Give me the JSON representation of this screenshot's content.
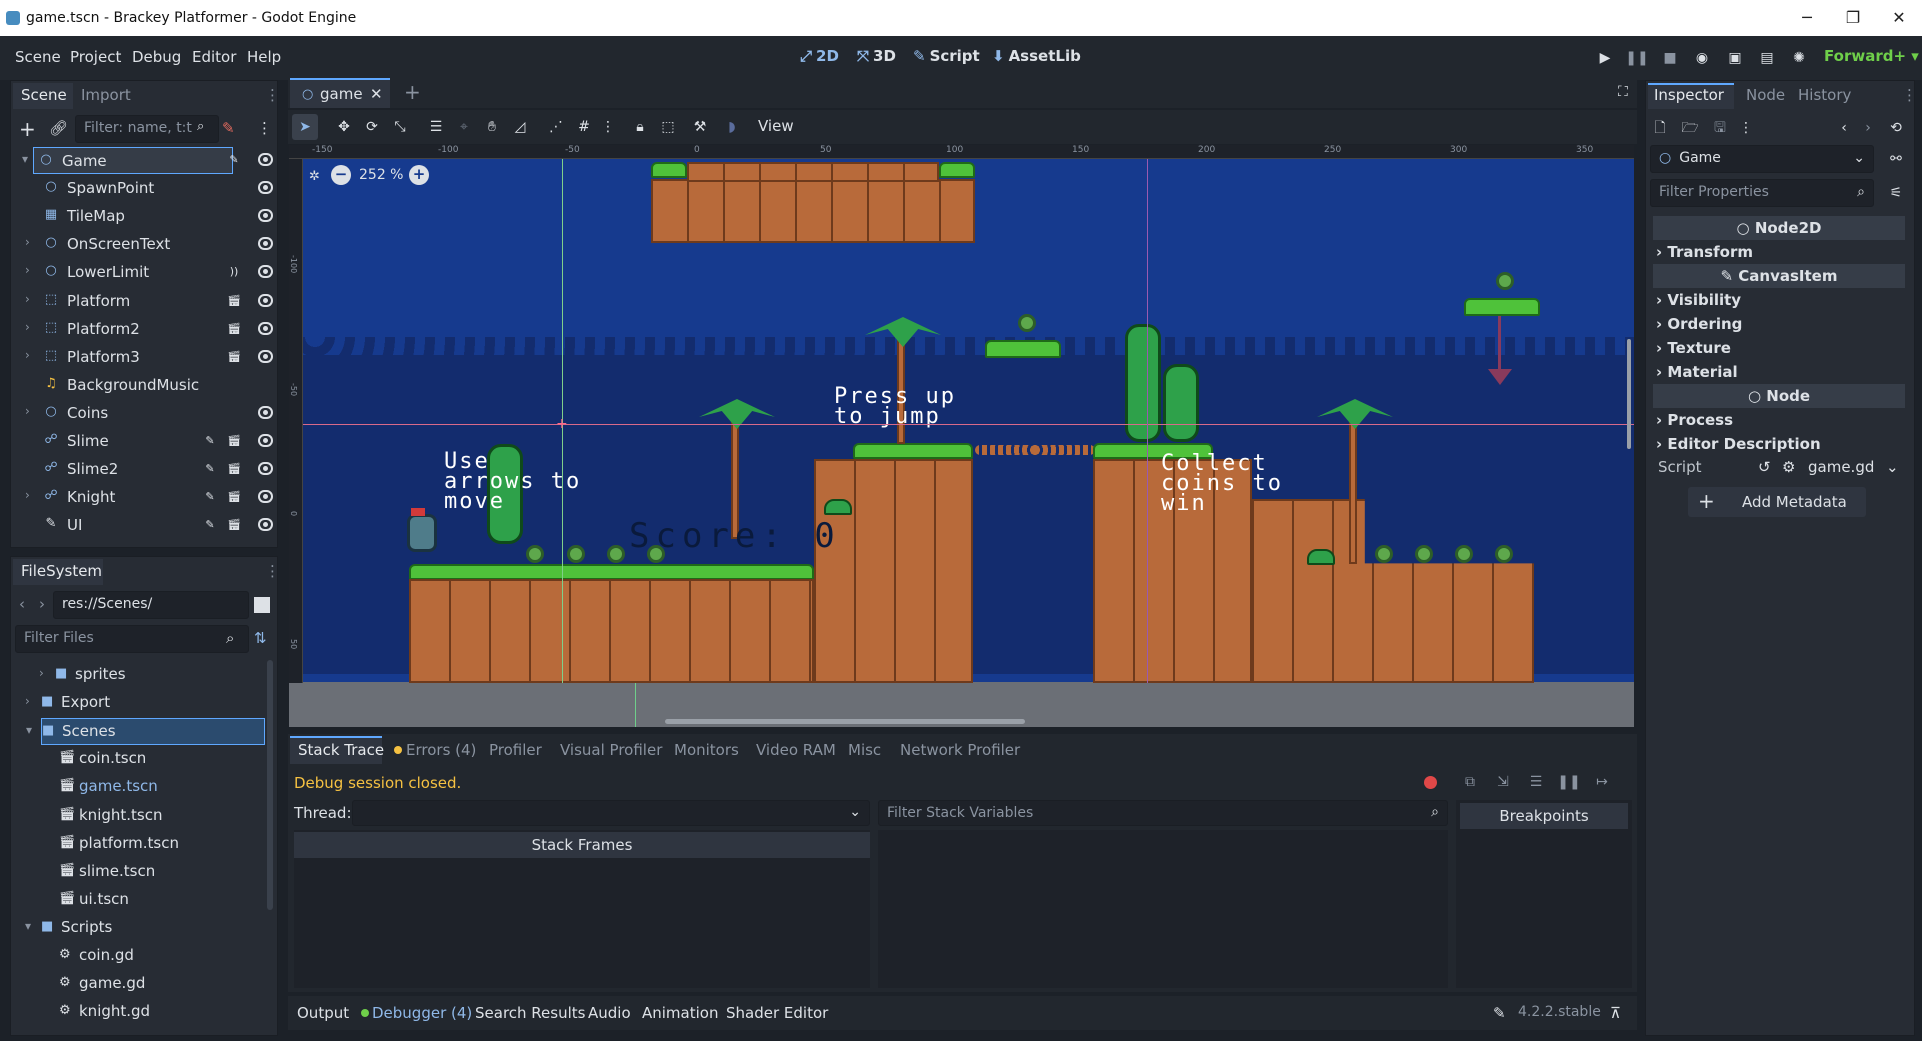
{
  "window": {
    "title": "game.tscn - Brackey Platformer - Godot Engine"
  },
  "menu": [
    "Scene",
    "Project",
    "Debug",
    "Editor",
    "Help"
  ],
  "workspaces": [
    "2D",
    "3D",
    "Script",
    "AssetLib"
  ],
  "renderer": "Forward+",
  "scene_dock": {
    "tabs": [
      "Scene",
      "Import"
    ],
    "filter_placeholder": "Filter: name, t:t",
    "nodes": [
      {
        "name": "Game",
        "icon": "node2d-icon",
        "depth": 0,
        "arrow": "▾"
      },
      {
        "name": "SpawnPoint",
        "icon": "node2d-icon",
        "depth": 1,
        "arrow": ""
      },
      {
        "name": "TileMap",
        "icon": "tilemap-icon",
        "depth": 1,
        "arrow": ""
      },
      {
        "name": "OnScreenText",
        "icon": "node2d-icon",
        "depth": 1,
        "arrow": "›"
      },
      {
        "name": "LowerLimit",
        "icon": "area-icon",
        "depth": 1,
        "arrow": "›"
      },
      {
        "name": "Platform",
        "icon": "body-icon",
        "depth": 1,
        "arrow": "›"
      },
      {
        "name": "Platform2",
        "icon": "body-icon",
        "depth": 1,
        "arrow": "›"
      },
      {
        "name": "Platform3",
        "icon": "body-icon",
        "depth": 1,
        "arrow": "›"
      },
      {
        "name": "BackgroundMusic",
        "icon": "audio-icon",
        "depth": 1,
        "arrow": ""
      },
      {
        "name": "Coins",
        "icon": "node2d-icon",
        "depth": 1,
        "arrow": "›"
      },
      {
        "name": "Slime",
        "icon": "scene-icon",
        "depth": 1,
        "arrow": ""
      },
      {
        "name": "Slime2",
        "icon": "scene-icon",
        "depth": 1,
        "arrow": ""
      },
      {
        "name": "Knight",
        "icon": "scene-icon",
        "depth": 1,
        "arrow": "›"
      },
      {
        "name": "UI",
        "icon": "canvas-icon",
        "depth": 1,
        "arrow": ""
      }
    ]
  },
  "filesystem": {
    "tab": "FileSystem",
    "path": "res://Scenes/",
    "filter_placeholder": "Filter Files",
    "items": [
      {
        "name": "sprites",
        "type": "folder",
        "depth": 1,
        "arrow": "›"
      },
      {
        "name": "Export",
        "type": "folder",
        "depth": 0,
        "arrow": "›"
      },
      {
        "name": "Scenes",
        "type": "folder",
        "depth": 0,
        "arrow": "▾",
        "selected": true
      },
      {
        "name": "coin.tscn",
        "type": "scene",
        "depth": 1
      },
      {
        "name": "game.tscn",
        "type": "scene",
        "depth": 1,
        "active": true
      },
      {
        "name": "knight.tscn",
        "type": "scene",
        "depth": 1
      },
      {
        "name": "platform.tscn",
        "type": "scene",
        "depth": 1
      },
      {
        "name": "slime.tscn",
        "type": "scene",
        "depth": 1
      },
      {
        "name": "ui.tscn",
        "type": "scene",
        "depth": 1
      },
      {
        "name": "Scripts",
        "type": "folder",
        "depth": 0,
        "arrow": "▾"
      },
      {
        "name": "coin.gd",
        "type": "script",
        "depth": 1
      },
      {
        "name": "game.gd",
        "type": "script",
        "depth": 1
      },
      {
        "name": "knight.gd",
        "type": "script",
        "depth": 1
      }
    ]
  },
  "editor": {
    "scene_tab": "game",
    "view_menu": "View",
    "zoom": "252 %",
    "ruler_labels": [
      "-150",
      "-100",
      "-50",
      "0",
      "50",
      "100",
      "150",
      "200",
      "250",
      "300",
      "350"
    ],
    "vruler_labels": [
      "-100",
      "-50",
      "0",
      "50"
    ],
    "level_text": {
      "move": "Use\narrows to\nmove",
      "jump": "Press up\nto jump",
      "coins": "Collect\ncoins to\nwin",
      "score": "Score: 0"
    }
  },
  "debugger": {
    "tabs": [
      "Stack Trace",
      "Errors (4)",
      "Profiler",
      "Visual Profiler",
      "Monitors",
      "Video RAM",
      "Misc",
      "Network Profiler"
    ],
    "status": "Debug session closed.",
    "thread_label": "Thread:",
    "stack_frames": "Stack Frames",
    "filter_vars_placeholder": "Filter Stack Variables",
    "breakpoints": "Breakpoints"
  },
  "bottom_panel": {
    "tabs": [
      "Output",
      "Debugger (4)",
      "Search Results",
      "Audio",
      "Animation",
      "Shader Editor"
    ],
    "version": "4.2.2.stable"
  },
  "inspector": {
    "tabs": [
      "Inspector",
      "Node",
      "History"
    ],
    "object": "Game",
    "filter_placeholder": "Filter Properties",
    "sections": [
      {
        "kind": "header",
        "label": "Node2D"
      },
      {
        "kind": "group",
        "label": "Transform"
      },
      {
        "kind": "header",
        "label": "CanvasItem"
      },
      {
        "kind": "group",
        "label": "Visibility"
      },
      {
        "kind": "group",
        "label": "Ordering"
      },
      {
        "kind": "group",
        "label": "Texture"
      },
      {
        "kind": "group",
        "label": "Material"
      },
      {
        "kind": "header",
        "label": "Node"
      },
      {
        "kind": "group",
        "label": "Process"
      },
      {
        "kind": "group",
        "label": "Editor Description"
      }
    ],
    "script_label": "Script",
    "script_value": "game.gd",
    "add_metadata": "Add Metadata"
  },
  "colors": {
    "accent": "#5fa8ff",
    "bg": "#1c2128",
    "panel": "#272c34",
    "viewport": "#163a8e"
  }
}
